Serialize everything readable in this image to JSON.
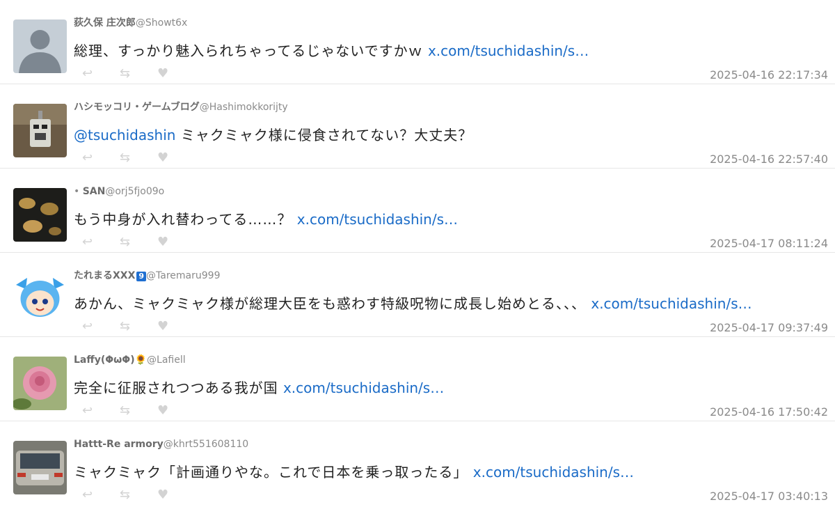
{
  "tweets": [
    {
      "display_name": "荻久保 庄次郎",
      "handle": "@Showt6x",
      "text": "総理、すっかり魅入られちゃってるじゃないですかｗ",
      "link": "x.com/tsuchidashin/s…",
      "timestamp": "2025-04-16 22:17:34",
      "avatar": "default-avatar"
    },
    {
      "display_name": "ハシモッコリ・ゲームブログ",
      "handle": "@Hashimokkorijty",
      "mention": "@tsuchidashin",
      "text": "ミャクミャク様に侵食されてない？大丈夫？",
      "timestamp": "2025-04-16 22:57:40",
      "avatar": "robot-avatar"
    },
    {
      "prefix": "•",
      "display_name": "SAN",
      "handle": "@orj5fjo09o",
      "text": "もう中身が入れ替わってる……？",
      "link": "x.com/tsuchidashin/s…",
      "timestamp": "2025-04-17 08:11:24",
      "avatar": "dark-photo-avatar"
    },
    {
      "display_name": "たれまるXXX",
      "badge": "9",
      "handle": "@Taremaru999",
      "text": "あかん、ミャクミャク様が総理大臣をも惑わす特級呪物に成長し始めとる、、、",
      "link": "x.com/tsuchidashin/s…",
      "timestamp": "2025-04-17 09:37:49",
      "avatar": "cartoon-avatar"
    },
    {
      "display_name": "Laffy(ΦωΦ)",
      "emoji": "🌻",
      "handle": "@Lafiell",
      "text": "完全に征服されつつある我が国",
      "link": "x.com/tsuchidashin/s…",
      "timestamp": "2025-04-16 17:50:42",
      "avatar": "rose-avatar"
    },
    {
      "display_name": "Hattt-Re armory",
      "handle": "@khrt551608110",
      "text": "ミャクミャク「計画通りやな。これで日本を乗っ取ったる」",
      "link": "x.com/tsuchidashin/s…",
      "timestamp": "2025-04-17 03:40:13",
      "avatar": "car-avatar"
    }
  ],
  "actions": {
    "reply_icon": "reply-icon",
    "retweet_icon": "retweet-icon",
    "like_icon": "heart-icon"
  },
  "colors": {
    "link": "#1a6bc7",
    "name": "#6b6b6b",
    "handle": "#8a8a8a",
    "action_icon": "#d3d3d3",
    "divider": "#e6e6e6"
  }
}
